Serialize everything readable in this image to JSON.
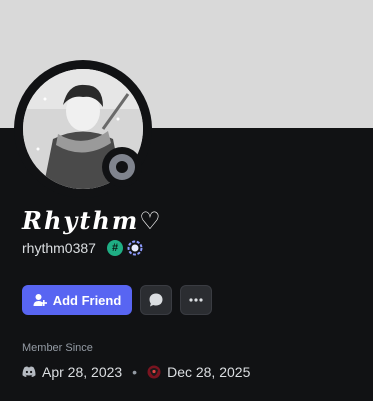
{
  "profile": {
    "display_name": "Rhythm",
    "display_name_decoration": "♡",
    "username": "rhythm0387",
    "badges": [
      "hashtag-badge-icon",
      "ring-badge-icon"
    ],
    "status": "offline"
  },
  "actions": {
    "add_friend_label": "Add Friend",
    "message_icon": "chat-bubble-icon",
    "more_icon": "more-dots-icon"
  },
  "member_since": {
    "label": "Member Since",
    "discord_date": "Apr 28, 2023",
    "server_date": "Dec 28, 2025"
  },
  "colors": {
    "banner": "#d9d9d9",
    "background": "#111214",
    "accent": "#5865f2",
    "status_offline": "#80848e"
  }
}
